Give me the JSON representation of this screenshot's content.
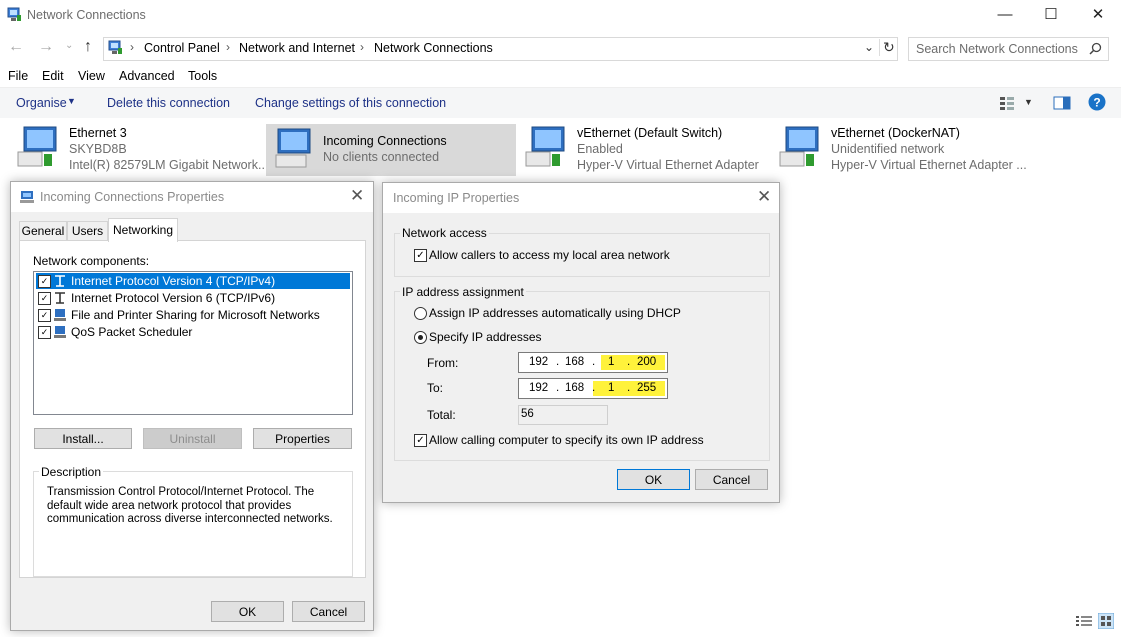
{
  "window": {
    "title": "Network Connections"
  },
  "address": {
    "crumbs": [
      "Control Panel",
      "Network and Internet",
      "Network Connections"
    ],
    "search_placeholder": "Search Network Connections"
  },
  "menu": [
    "File",
    "Edit",
    "View",
    "Advanced",
    "Tools"
  ],
  "commands": {
    "organise": "Organise",
    "delete": "Delete this connection",
    "change": "Change settings of this connection"
  },
  "connections": [
    {
      "name": "Ethernet 3",
      "status": "SKYBD8B",
      "adapter": "Intel(R) 82579LM Gigabit Network..."
    },
    {
      "name": "Incoming Connections",
      "status": "No clients connected",
      "adapter": ""
    },
    {
      "name": "vEthernet (Default Switch)",
      "status": "Enabled",
      "adapter": "Hyper-V Virtual Ethernet Adapter"
    },
    {
      "name": "vEthernet (DockerNAT)",
      "status": "Unidentified network",
      "adapter": "Hyper-V Virtual Ethernet Adapter ..."
    }
  ],
  "props_dialog": {
    "title": "Incoming Connections Properties",
    "tabs": [
      "General",
      "Users",
      "Networking"
    ],
    "components_label": "Network components:",
    "components": [
      {
        "label": "Internet Protocol Version 4 (TCP/IPv4)",
        "checked": true,
        "selected": true
      },
      {
        "label": "Internet Protocol Version 6 (TCP/IPv6)",
        "checked": true,
        "selected": false
      },
      {
        "label": "File and Printer Sharing for Microsoft Networks",
        "checked": true,
        "selected": false
      },
      {
        "label": "QoS Packet Scheduler",
        "checked": true,
        "selected": false
      }
    ],
    "install": "Install...",
    "uninstall": "Uninstall",
    "properties": "Properties",
    "description_label": "Description",
    "description": "Transmission Control Protocol/Internet Protocol. The default wide area network protocol that provides communication across diverse interconnected networks.",
    "ok": "OK",
    "cancel": "Cancel"
  },
  "ip_dialog": {
    "title": "Incoming IP Properties",
    "network_access_label": "Network access",
    "allow_lan": "Allow callers to access my local area network",
    "allow_lan_checked": true,
    "assignment_label": "IP address assignment",
    "dhcp": "Assign IP addresses automatically using DHCP",
    "specify": "Specify IP addresses",
    "selected_mode": "specify",
    "from_label": "From:",
    "to_label": "To:",
    "total_label": "Total:",
    "from": [
      "192",
      "168",
      "1",
      "200"
    ],
    "to": [
      "192",
      "168",
      "1",
      "255"
    ],
    "total": "56",
    "allow_own_ip": "Allow calling computer to specify its own IP address",
    "allow_own_ip_checked": true,
    "ok": "OK",
    "cancel": "Cancel"
  },
  "colors": {
    "accent": "#0078d7",
    "highlight": "#fff23b",
    "selection": "#0078d7",
    "link": "#1e3287"
  }
}
